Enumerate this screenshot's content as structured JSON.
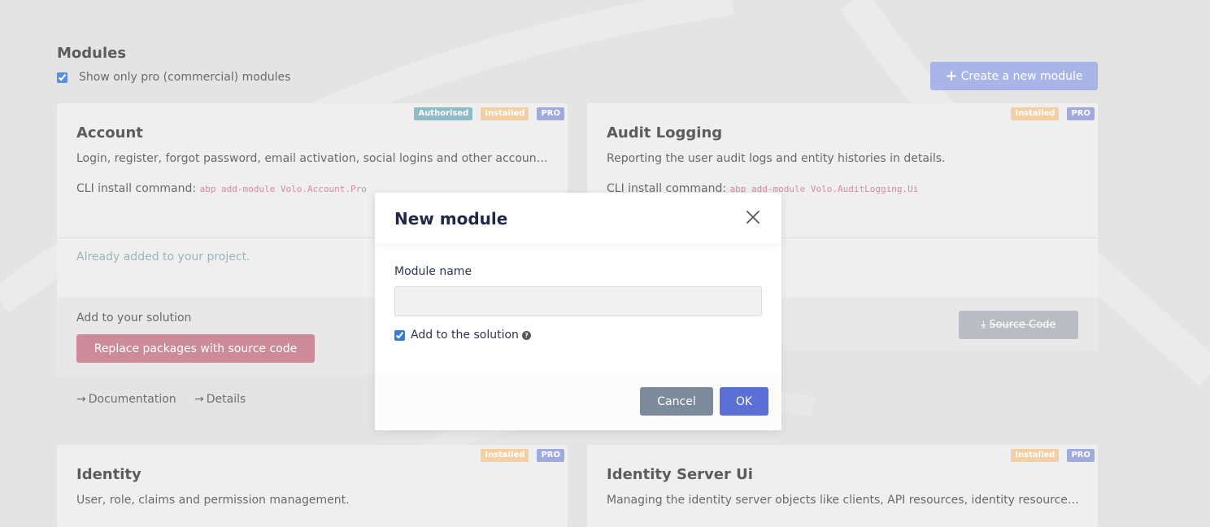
{
  "page": {
    "title": "Modules",
    "pro_filter_label": "Show only pro (commercial) modules",
    "pro_filter_checked": true,
    "create_button_label": "Create a new module"
  },
  "badges": {
    "authorised": "Authorised",
    "installed": "Installed",
    "pro": "PRO"
  },
  "cards": {
    "account": {
      "title": "Account",
      "description": "Login, register, forgot password, email activation, social logins and other account r...",
      "cli_label": "CLI install command:",
      "cli_command": "abp add-module Volo.Account.Pro",
      "already_added": "Already added to your project.",
      "solution_label": "Add to your solution",
      "replace_button": "Replace packages with source code",
      "documentation_link": "Documentation",
      "details_link": "Details"
    },
    "audit_logging": {
      "title": "Audit Logging",
      "description": "Reporting the user audit logs and entity histories in details.",
      "cli_label": "CLI install command:",
      "cli_command": "abp add-module Volo.AuditLogging.Ui",
      "source_code_button": "Source Code"
    },
    "identity": {
      "title": "Identity",
      "description": "User, role, claims and permission management."
    },
    "identity_server_ui": {
      "title": "Identity Server Ui",
      "description": "Managing the identity server objects like clients, API resources, identity resources, ..."
    }
  },
  "modal": {
    "title": "New module",
    "module_name_label": "Module name",
    "module_name_value": "",
    "add_to_solution_label": "Add to the solution",
    "add_to_solution_checked": true,
    "cancel_button": "Cancel",
    "ok_button": "OK"
  },
  "colors": {
    "accent": "#5b6fd6",
    "create_button": "#a9b5e6",
    "replace_button": "#cb8b98",
    "cancel_button": "#7d8a9c"
  }
}
